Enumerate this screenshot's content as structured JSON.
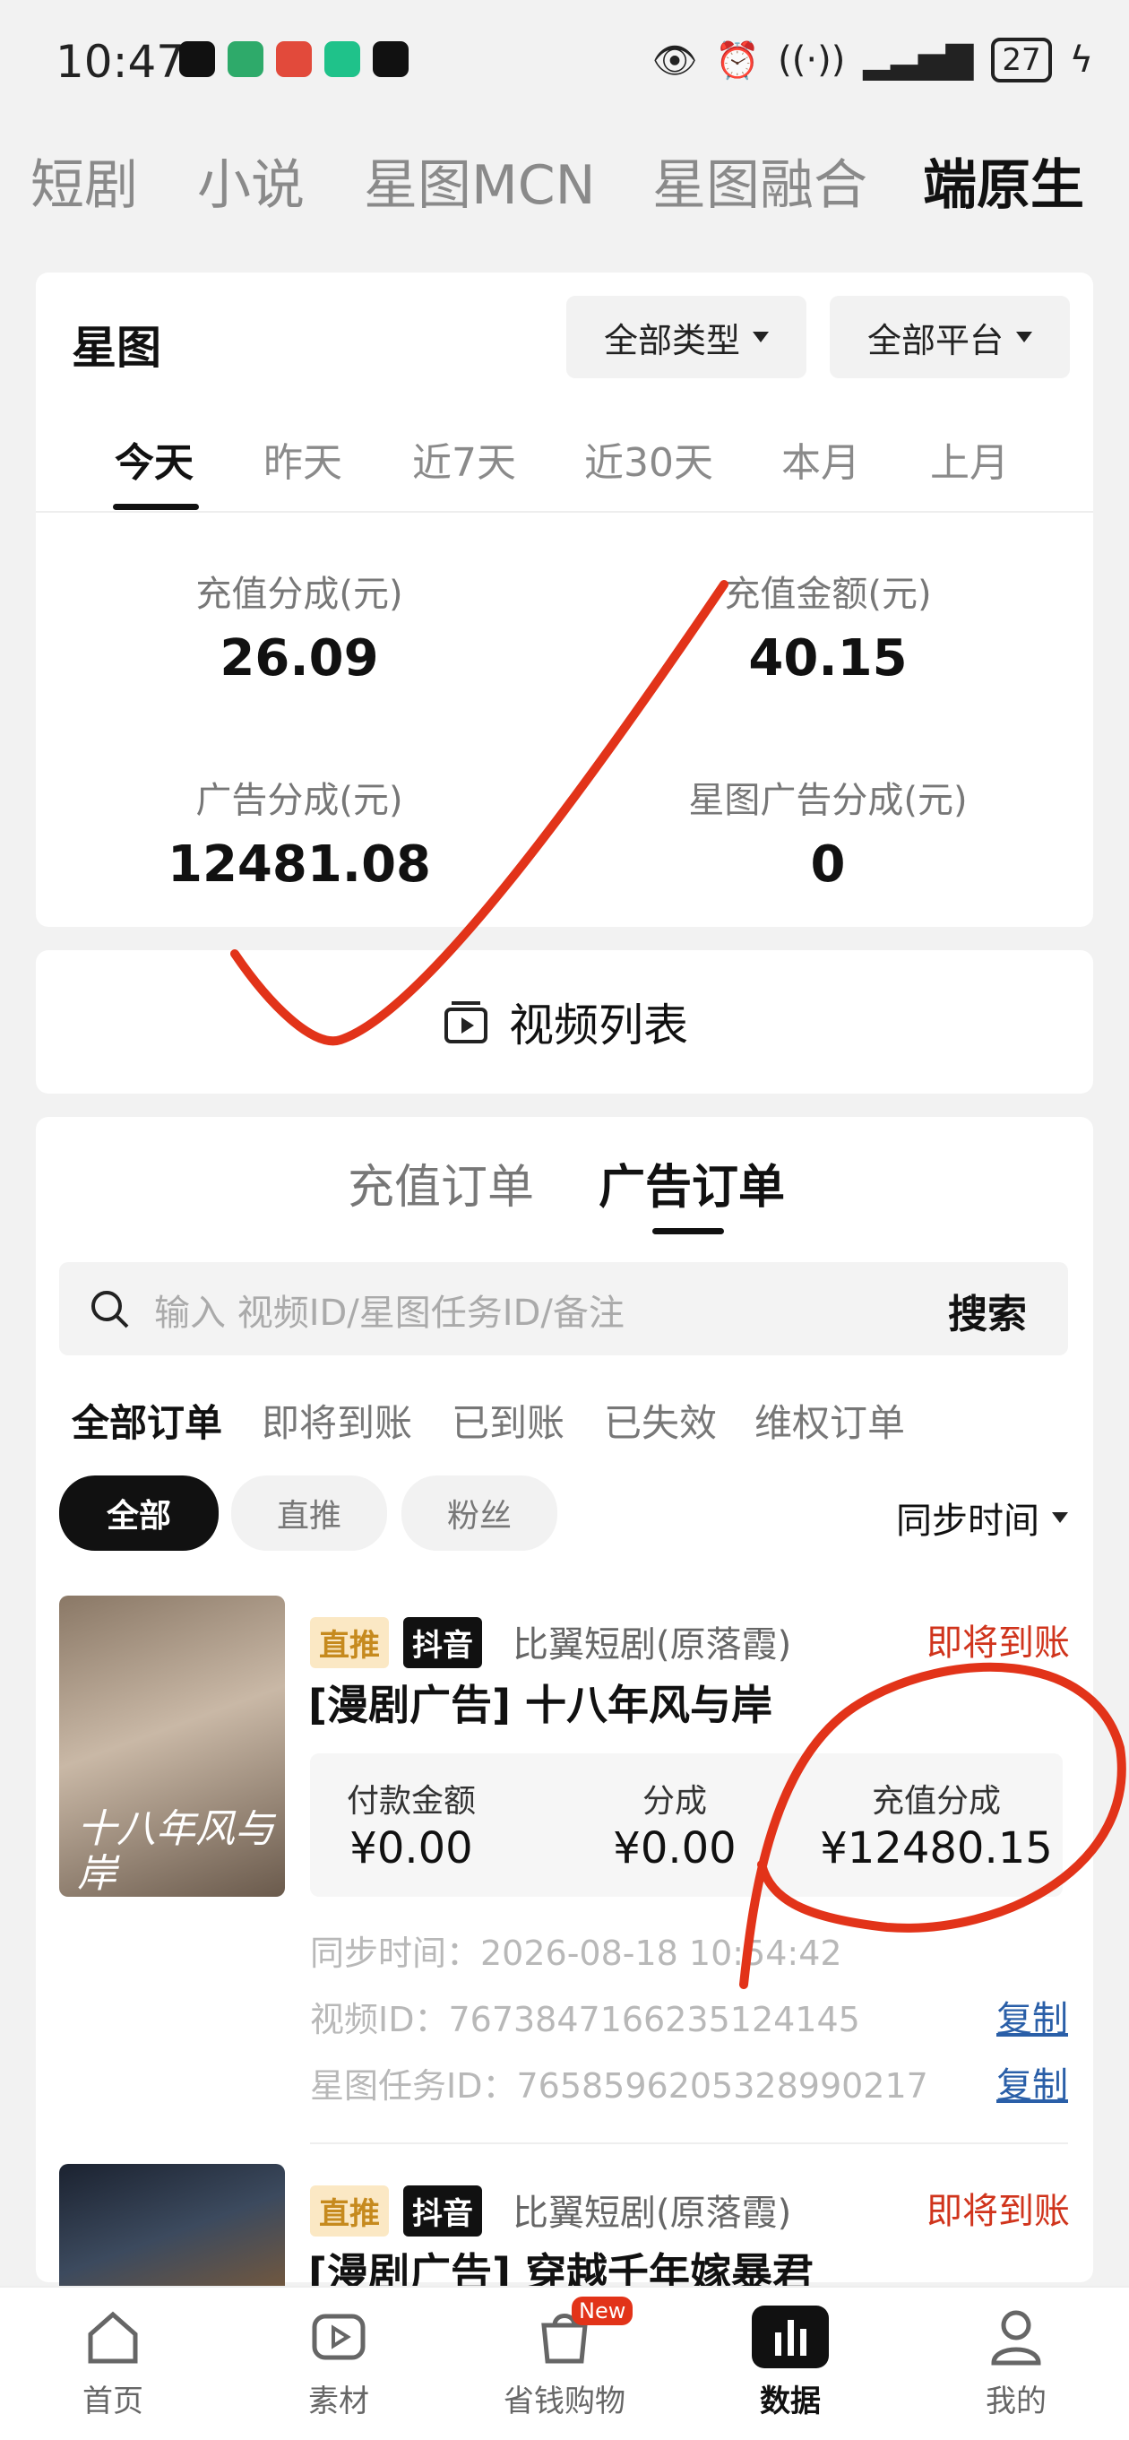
{
  "status": {
    "time": "10:47",
    "battery": "27"
  },
  "top_tabs": [
    "短剧",
    "小说",
    "星图MCN",
    "星图融合",
    "端原生"
  ],
  "xingtu": {
    "title": "星图",
    "type_filter": "全部类型",
    "platform_filter": "全部平台",
    "date_tabs": [
      "今天",
      "昨天",
      "近7天",
      "近30天",
      "本月",
      "上月"
    ],
    "stats": [
      {
        "label": "充值分成(元)",
        "value": "26.09"
      },
      {
        "label": "充值金额(元)",
        "value": "40.15"
      },
      {
        "label": "广告分成(元)",
        "value": "12481.08"
      },
      {
        "label": "星图广告分成(元)",
        "value": "0"
      }
    ]
  },
  "video_list_label": "视频列表",
  "orders": {
    "tabs": [
      "充值订单",
      "广告订单"
    ],
    "search_placeholder": "输入 视频ID/星图任务ID/备注",
    "search_button": "搜索",
    "status_filters": [
      "全部订单",
      "即将到账",
      "已到账",
      "已失效",
      "维权订单"
    ],
    "chips": [
      "全部",
      "直推",
      "粉丝"
    ],
    "sort_label": "同步时间",
    "items": [
      {
        "poster_text": "十八年风与岸",
        "tag1": "直推",
        "tag2": "抖音",
        "source": "比翼短剧(原落霞)",
        "status": "即将到账",
        "title": "[漫剧广告] 十八年风与岸",
        "amount_label": "付款金额",
        "amount": "¥0.00",
        "share_label": "分成",
        "share": "¥0.00",
        "recharge_label": "充值分成",
        "recharge": "¥12480.15",
        "sync_time": "同步时间：2026-08-18 10:54:42",
        "video_id": "视频ID：7673847166235124145",
        "task_id": "星图任务ID：7658596205328990217",
        "copy": "复制"
      },
      {
        "tag1": "直推",
        "tag2": "抖音",
        "source": "比翼短剧(原落霞)",
        "status": "即将到账",
        "title": "[漫剧广告] 穿越千年嫁暴君"
      }
    ]
  },
  "tabbar": {
    "items": [
      "首页",
      "素材",
      "省钱购物",
      "数据",
      "我的"
    ],
    "new_badge": "New"
  },
  "colors": {
    "accent_red": "#d0341c",
    "badge_yellow": "#fbe8c4",
    "link_blue": "#2a5fa8"
  }
}
